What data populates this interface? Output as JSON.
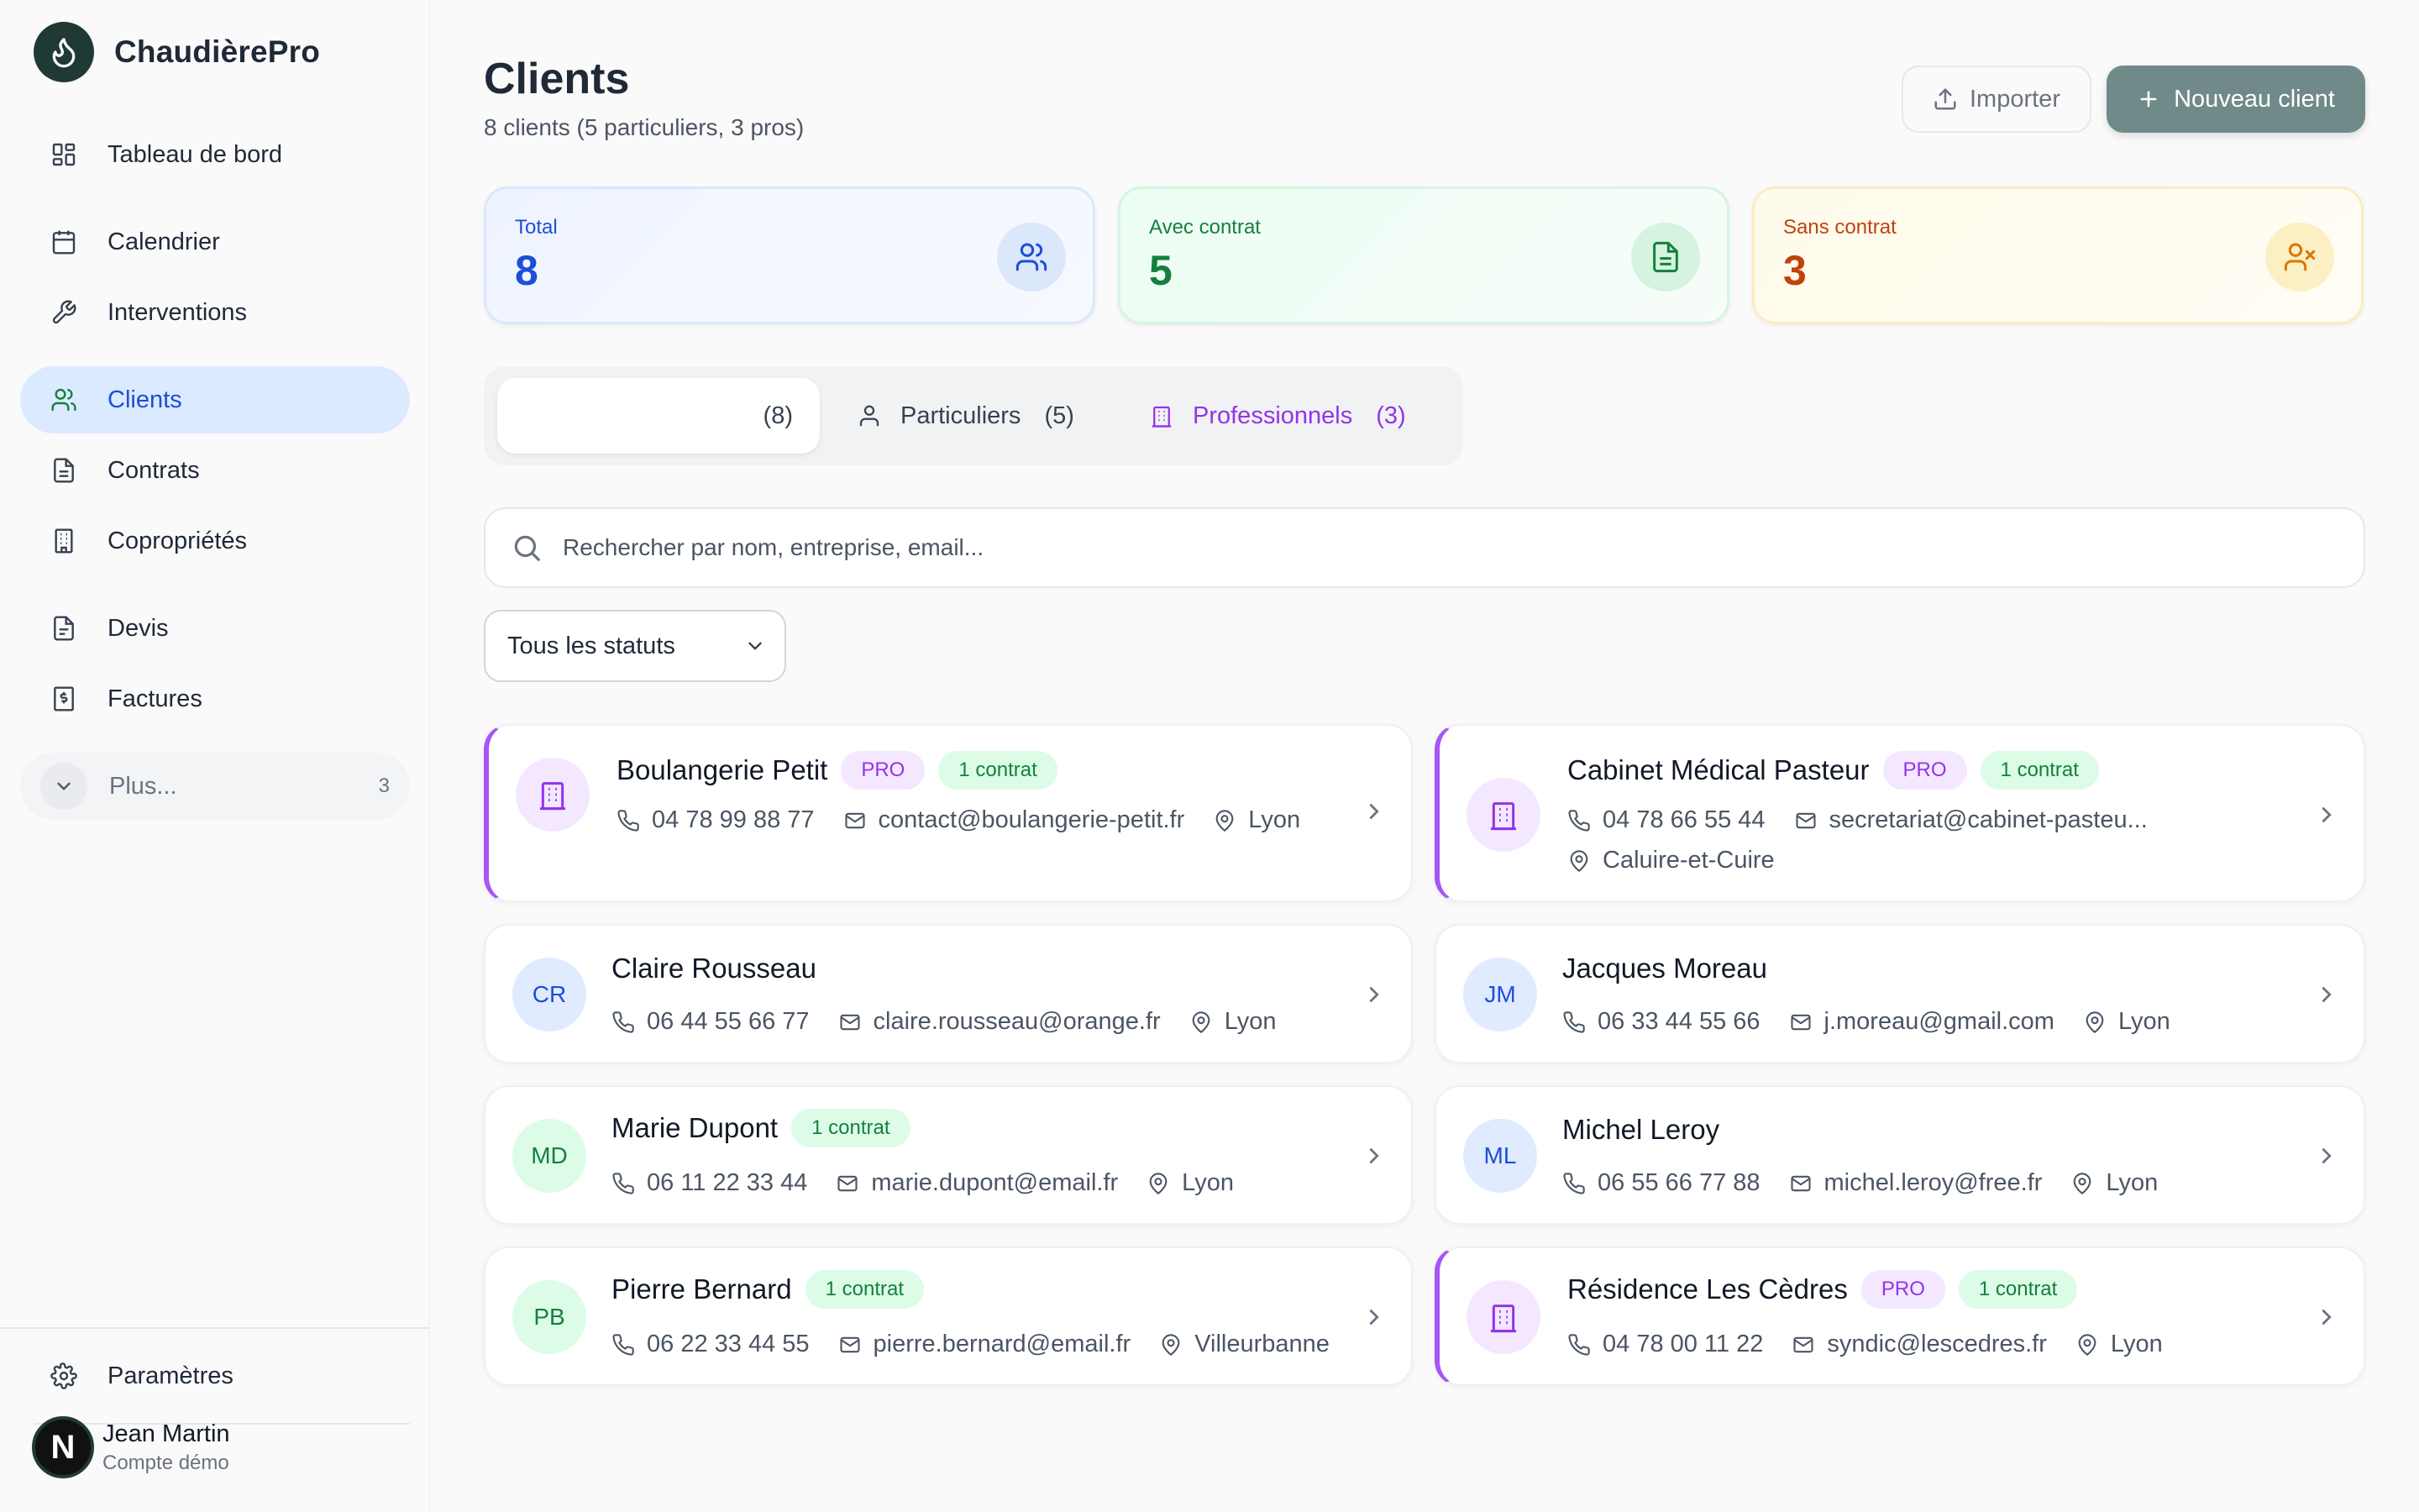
{
  "brand": {
    "name": "ChaudièrePro"
  },
  "nav": {
    "dashboard": "Tableau de bord",
    "calendar": "Calendrier",
    "interventions": "Interventions",
    "clients": "Clients",
    "contracts": "Contrats",
    "coproprietes": "Copropriétés",
    "devis": "Devis",
    "factures": "Factures",
    "more": "Plus...",
    "more_count": "3",
    "settings": "Paramètres"
  },
  "user": {
    "initial": "N",
    "name": "Jean Martin",
    "sub": "Compte démo"
  },
  "header": {
    "title": "Clients",
    "subtitle": "8 clients  (5 particuliers, 3 pros)",
    "import_label": "Importer",
    "new_label": "Nouveau client"
  },
  "stats": {
    "total": {
      "label": "Total",
      "value": "8"
    },
    "with_contract": {
      "label": "Avec contrat",
      "value": "5"
    },
    "without_contract": {
      "label": "Sans contrat",
      "value": "3"
    }
  },
  "tabs": {
    "all_count": "(8)",
    "individuals": {
      "label": "Particuliers",
      "count": "(5)"
    },
    "pros": {
      "label": "Professionnels",
      "count": "(3)"
    }
  },
  "search": {
    "placeholder": "Rechercher par nom, entreprise, email..."
  },
  "filter": {
    "selected": "Tous les statuts"
  },
  "colors": {
    "accent": "#6f8a88",
    "active_nav": "#dbeafe",
    "pro": "#a855f7",
    "contract": "#15803d"
  },
  "clients": [
    {
      "name": "Boulangerie Petit",
      "pro_tag": "PRO",
      "contract_tag": "1 contrat",
      "phone": "04 78 99 88 77",
      "email": "contact@boulangerie-petit.fr",
      "city": "Lyon"
    },
    {
      "name": "Cabinet Médical Pasteur",
      "pro_tag": "PRO",
      "contract_tag": "1 contrat",
      "phone": "04 78 66 55 44",
      "email": "secretariat@cabinet-pasteu...",
      "city": "Caluire-et-Cuire"
    },
    {
      "initials": "CR",
      "name": "Claire Rousseau",
      "phone": "06 44 55 66 77",
      "email": "claire.rousseau@orange.fr",
      "city": "Lyon"
    },
    {
      "initials": "JM",
      "name": "Jacques Moreau",
      "phone": "06 33 44 55 66",
      "email": "j.moreau@gmail.com",
      "city": "Lyon"
    },
    {
      "initials": "MD",
      "name": "Marie Dupont",
      "contract_tag": "1 contrat",
      "phone": "06 11 22 33 44",
      "email": "marie.dupont@email.fr",
      "city": "Lyon"
    },
    {
      "initials": "ML",
      "name": "Michel Leroy",
      "phone": "06 55 66 77 88",
      "email": "michel.leroy@free.fr",
      "city": "Lyon"
    },
    {
      "initials": "PB",
      "name": "Pierre Bernard",
      "contract_tag": "1 contrat",
      "phone": "06 22 33 44 55",
      "email": "pierre.bernard@email.fr",
      "city": "Villeurbanne"
    },
    {
      "name": "Résidence Les Cèdres",
      "pro_tag": "PRO",
      "contract_tag": "1 contrat",
      "phone": "04 78 00 11 22",
      "email": "syndic@lescedres.fr",
      "city": "Lyon"
    }
  ]
}
